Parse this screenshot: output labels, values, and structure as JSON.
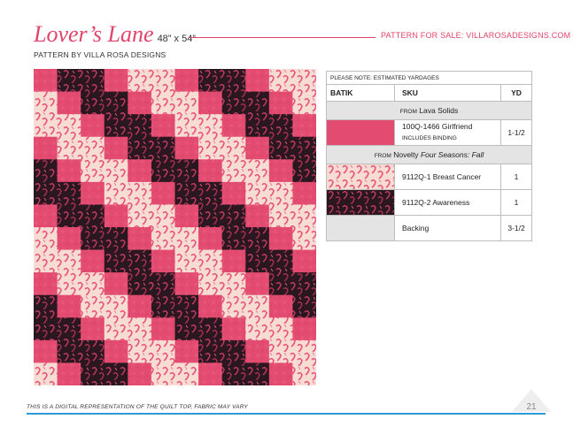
{
  "header": {
    "title": "Lover’s Lane",
    "dimensions": "48” x 54”",
    "sale_text": "PATTERN FOR SALE: VILLAROSADESIGNS.COM",
    "byline": "PATTERN BY VILLA ROSA DESIGNS"
  },
  "table": {
    "note": "PLEASE NOTE: ESTIMATED YARDAGES",
    "col_batik": "BATIK",
    "col_sku": "SKU",
    "col_yd": "YD",
    "group1": {
      "prefix": "FROM",
      "name": "Lava Solids"
    },
    "group2": {
      "prefix": "FROM",
      "name": "Novelty",
      "collection": "Four Seasons: Fall"
    },
    "rows": [
      {
        "sku": "100Q-1466 Girlfriend",
        "sub": "INCLUDES BINDING",
        "yd": "1-1/2"
      },
      {
        "sku": "9112Q-1 Breast Cancer",
        "yd": "1"
      },
      {
        "sku": "9112Q-2 Awareness",
        "yd": "1"
      },
      {
        "sku": "Backing",
        "yd": "3-1/2"
      }
    ]
  },
  "colors": {
    "accent": "#e0456a",
    "solid_pink": "#e34c70",
    "cream": "#f6dcd2",
    "dark": "#2a1720",
    "footer_rule": "#2a9bd4"
  },
  "footer": {
    "note": "THIS IS A DIGITAL REPRESENTATION OF THE QUILT TOP, FABRIC MAY VARY",
    "page_number": "21"
  }
}
